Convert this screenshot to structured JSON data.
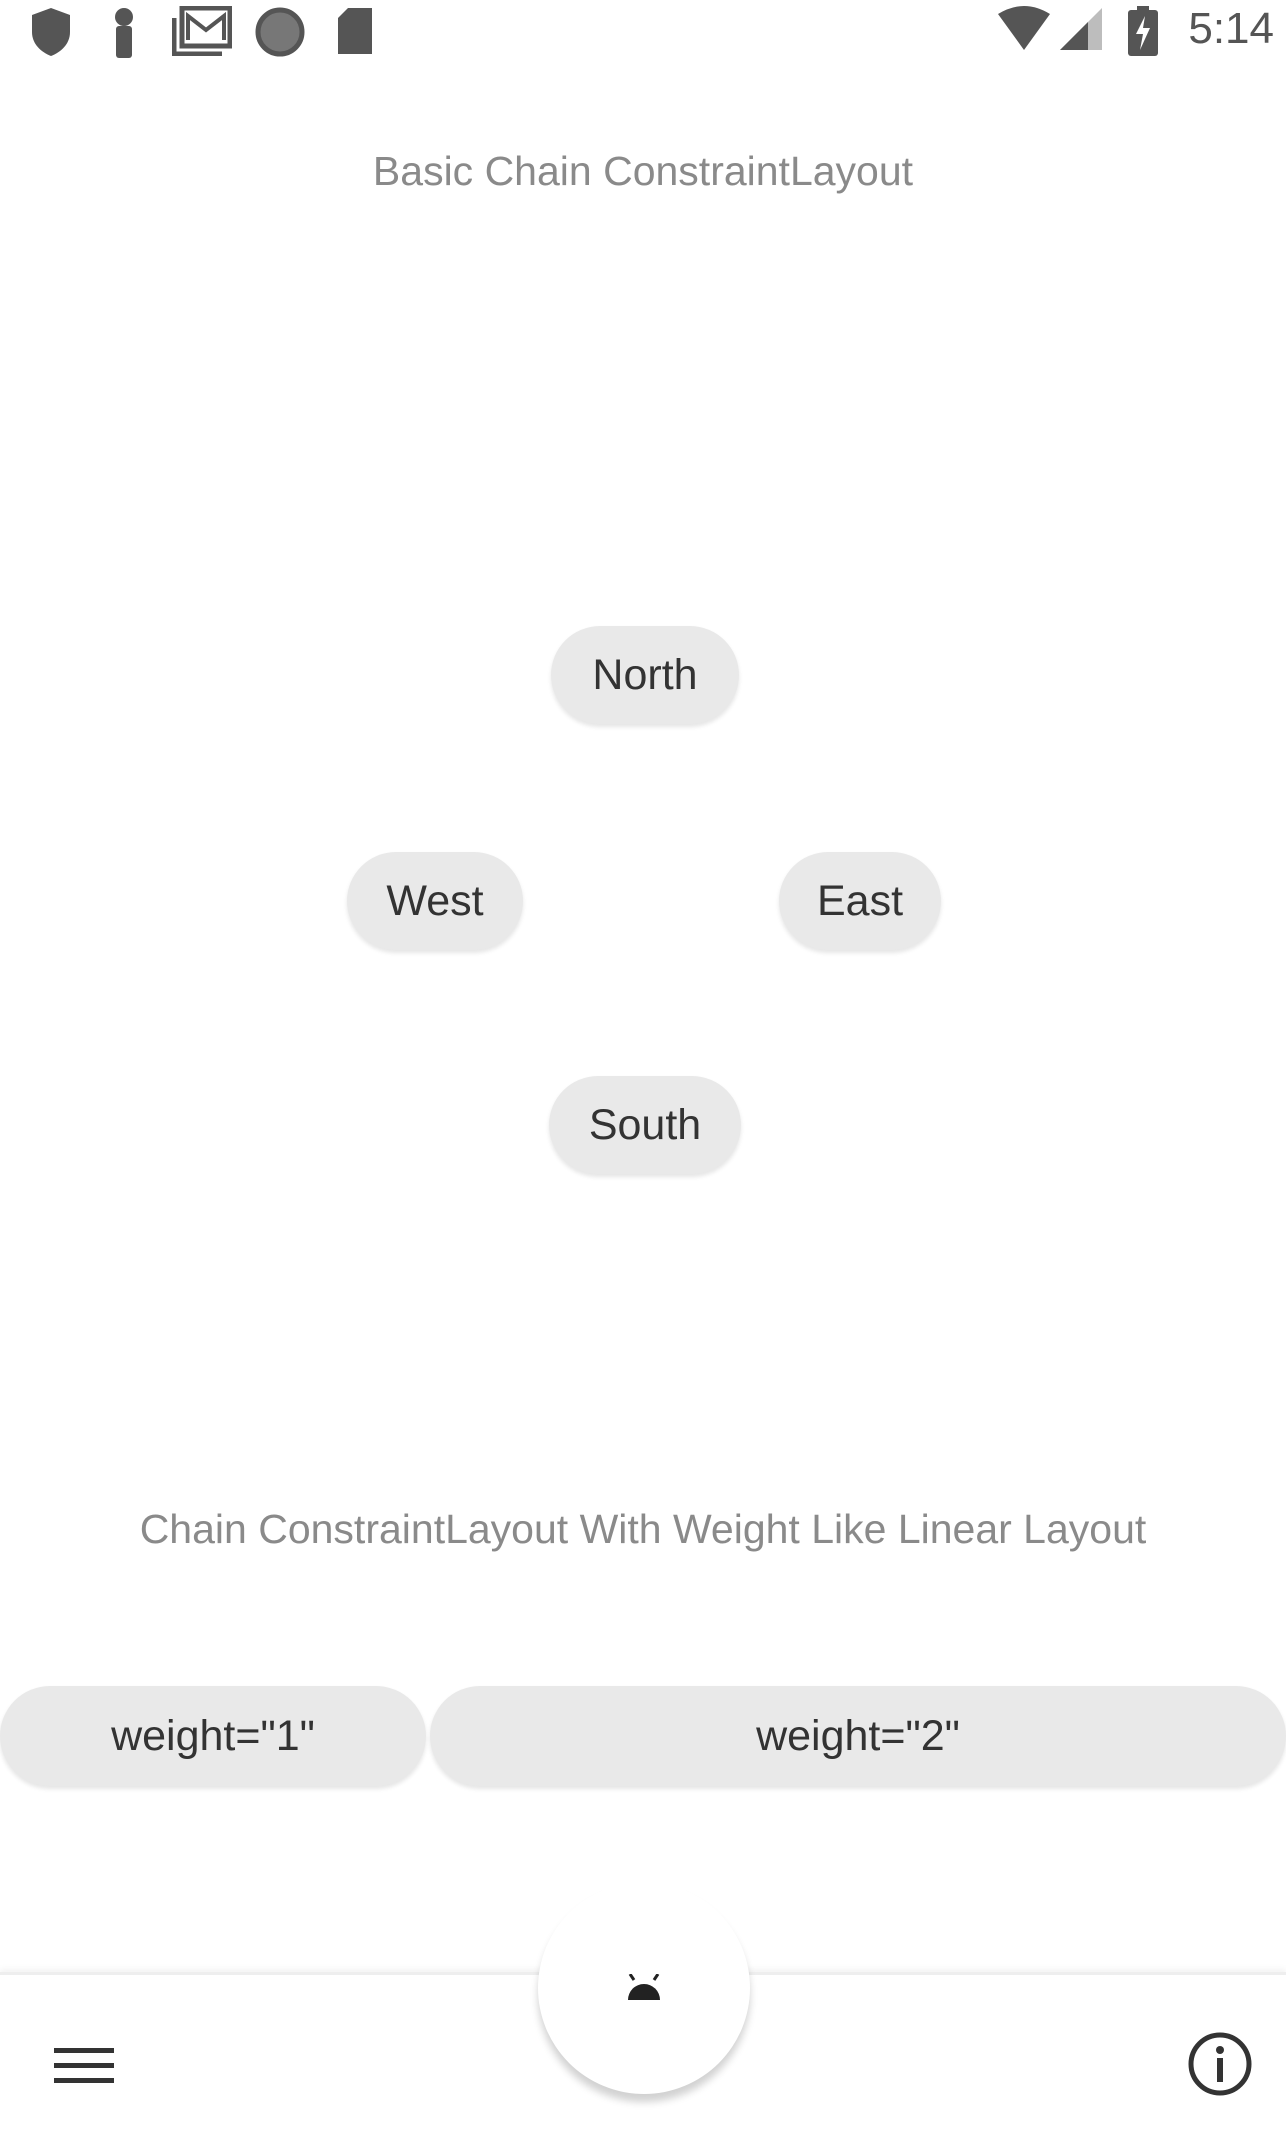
{
  "status_bar": {
    "time": "5:14",
    "left_icons": [
      "shield-icon",
      "key-icon",
      "gmail-icon",
      "circle-icon",
      "sd-card-icon"
    ],
    "right_icons": [
      "wifi-icon",
      "signal-icon",
      "battery-charging-icon"
    ]
  },
  "basic_chain": {
    "title": "Basic Chain ConstraintLayout",
    "north_label": "North",
    "west_label": "West",
    "east_label": "East",
    "south_label": "South"
  },
  "weight_chain": {
    "title": "Chain ConstraintLayout With Weight Like Linear Layout",
    "weight1_label": "weight=\"1\"",
    "weight2_label": "weight=\"2\""
  },
  "bottom_bar": {
    "menu_icon": "menu-icon",
    "fab_icon": "android-icon",
    "info_icon": "info-icon"
  },
  "colors": {
    "button_bg": "#e9e9e9",
    "title_text": "#8a8a8a",
    "button_text": "#333333",
    "icon": "#555555"
  }
}
